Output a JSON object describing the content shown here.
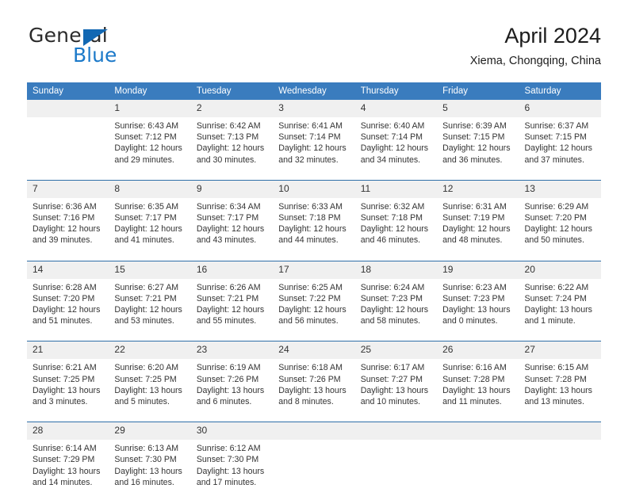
{
  "brand": {
    "name_top": "General",
    "name_bottom": "Blue",
    "accent_color": "#1b79c9"
  },
  "header": {
    "title": "April 2024",
    "subtitle": "Xiema, Chongqing, China"
  },
  "calendar": {
    "header_color": "#3a7cbe",
    "weekday_headers": [
      "Sunday",
      "Monday",
      "Tuesday",
      "Wednesday",
      "Thursday",
      "Friday",
      "Saturday"
    ],
    "weeks": [
      [
        {
          "day": "",
          "sunrise": "",
          "sunset": "",
          "daylight": ""
        },
        {
          "day": "1",
          "sunrise": "Sunrise: 6:43 AM",
          "sunset": "Sunset: 7:12 PM",
          "daylight": "Daylight: 12 hours and 29 minutes."
        },
        {
          "day": "2",
          "sunrise": "Sunrise: 6:42 AM",
          "sunset": "Sunset: 7:13 PM",
          "daylight": "Daylight: 12 hours and 30 minutes."
        },
        {
          "day": "3",
          "sunrise": "Sunrise: 6:41 AM",
          "sunset": "Sunset: 7:14 PM",
          "daylight": "Daylight: 12 hours and 32 minutes."
        },
        {
          "day": "4",
          "sunrise": "Sunrise: 6:40 AM",
          "sunset": "Sunset: 7:14 PM",
          "daylight": "Daylight: 12 hours and 34 minutes."
        },
        {
          "day": "5",
          "sunrise": "Sunrise: 6:39 AM",
          "sunset": "Sunset: 7:15 PM",
          "daylight": "Daylight: 12 hours and 36 minutes."
        },
        {
          "day": "6",
          "sunrise": "Sunrise: 6:37 AM",
          "sunset": "Sunset: 7:15 PM",
          "daylight": "Daylight: 12 hours and 37 minutes."
        }
      ],
      [
        {
          "day": "7",
          "sunrise": "Sunrise: 6:36 AM",
          "sunset": "Sunset: 7:16 PM",
          "daylight": "Daylight: 12 hours and 39 minutes."
        },
        {
          "day": "8",
          "sunrise": "Sunrise: 6:35 AM",
          "sunset": "Sunset: 7:17 PM",
          "daylight": "Daylight: 12 hours and 41 minutes."
        },
        {
          "day": "9",
          "sunrise": "Sunrise: 6:34 AM",
          "sunset": "Sunset: 7:17 PM",
          "daylight": "Daylight: 12 hours and 43 minutes."
        },
        {
          "day": "10",
          "sunrise": "Sunrise: 6:33 AM",
          "sunset": "Sunset: 7:18 PM",
          "daylight": "Daylight: 12 hours and 44 minutes."
        },
        {
          "day": "11",
          "sunrise": "Sunrise: 6:32 AM",
          "sunset": "Sunset: 7:18 PM",
          "daylight": "Daylight: 12 hours and 46 minutes."
        },
        {
          "day": "12",
          "sunrise": "Sunrise: 6:31 AM",
          "sunset": "Sunset: 7:19 PM",
          "daylight": "Daylight: 12 hours and 48 minutes."
        },
        {
          "day": "13",
          "sunrise": "Sunrise: 6:29 AM",
          "sunset": "Sunset: 7:20 PM",
          "daylight": "Daylight: 12 hours and 50 minutes."
        }
      ],
      [
        {
          "day": "14",
          "sunrise": "Sunrise: 6:28 AM",
          "sunset": "Sunset: 7:20 PM",
          "daylight": "Daylight: 12 hours and 51 minutes."
        },
        {
          "day": "15",
          "sunrise": "Sunrise: 6:27 AM",
          "sunset": "Sunset: 7:21 PM",
          "daylight": "Daylight: 12 hours and 53 minutes."
        },
        {
          "day": "16",
          "sunrise": "Sunrise: 6:26 AM",
          "sunset": "Sunset: 7:21 PM",
          "daylight": "Daylight: 12 hours and 55 minutes."
        },
        {
          "day": "17",
          "sunrise": "Sunrise: 6:25 AM",
          "sunset": "Sunset: 7:22 PM",
          "daylight": "Daylight: 12 hours and 56 minutes."
        },
        {
          "day": "18",
          "sunrise": "Sunrise: 6:24 AM",
          "sunset": "Sunset: 7:23 PM",
          "daylight": "Daylight: 12 hours and 58 minutes."
        },
        {
          "day": "19",
          "sunrise": "Sunrise: 6:23 AM",
          "sunset": "Sunset: 7:23 PM",
          "daylight": "Daylight: 13 hours and 0 minutes."
        },
        {
          "day": "20",
          "sunrise": "Sunrise: 6:22 AM",
          "sunset": "Sunset: 7:24 PM",
          "daylight": "Daylight: 13 hours and 1 minute."
        }
      ],
      [
        {
          "day": "21",
          "sunrise": "Sunrise: 6:21 AM",
          "sunset": "Sunset: 7:25 PM",
          "daylight": "Daylight: 13 hours and 3 minutes."
        },
        {
          "day": "22",
          "sunrise": "Sunrise: 6:20 AM",
          "sunset": "Sunset: 7:25 PM",
          "daylight": "Daylight: 13 hours and 5 minutes."
        },
        {
          "day": "23",
          "sunrise": "Sunrise: 6:19 AM",
          "sunset": "Sunset: 7:26 PM",
          "daylight": "Daylight: 13 hours and 6 minutes."
        },
        {
          "day": "24",
          "sunrise": "Sunrise: 6:18 AM",
          "sunset": "Sunset: 7:26 PM",
          "daylight": "Daylight: 13 hours and 8 minutes."
        },
        {
          "day": "25",
          "sunrise": "Sunrise: 6:17 AM",
          "sunset": "Sunset: 7:27 PM",
          "daylight": "Daylight: 13 hours and 10 minutes."
        },
        {
          "day": "26",
          "sunrise": "Sunrise: 6:16 AM",
          "sunset": "Sunset: 7:28 PM",
          "daylight": "Daylight: 13 hours and 11 minutes."
        },
        {
          "day": "27",
          "sunrise": "Sunrise: 6:15 AM",
          "sunset": "Sunset: 7:28 PM",
          "daylight": "Daylight: 13 hours and 13 minutes."
        }
      ],
      [
        {
          "day": "28",
          "sunrise": "Sunrise: 6:14 AM",
          "sunset": "Sunset: 7:29 PM",
          "daylight": "Daylight: 13 hours and 14 minutes."
        },
        {
          "day": "29",
          "sunrise": "Sunrise: 6:13 AM",
          "sunset": "Sunset: 7:30 PM",
          "daylight": "Daylight: 13 hours and 16 minutes."
        },
        {
          "day": "30",
          "sunrise": "Sunrise: 6:12 AM",
          "sunset": "Sunset: 7:30 PM",
          "daylight": "Daylight: 13 hours and 17 minutes."
        },
        {
          "day": "",
          "sunrise": "",
          "sunset": "",
          "daylight": ""
        },
        {
          "day": "",
          "sunrise": "",
          "sunset": "",
          "daylight": ""
        },
        {
          "day": "",
          "sunrise": "",
          "sunset": "",
          "daylight": ""
        },
        {
          "day": "",
          "sunrise": "",
          "sunset": "",
          "daylight": ""
        }
      ]
    ]
  }
}
